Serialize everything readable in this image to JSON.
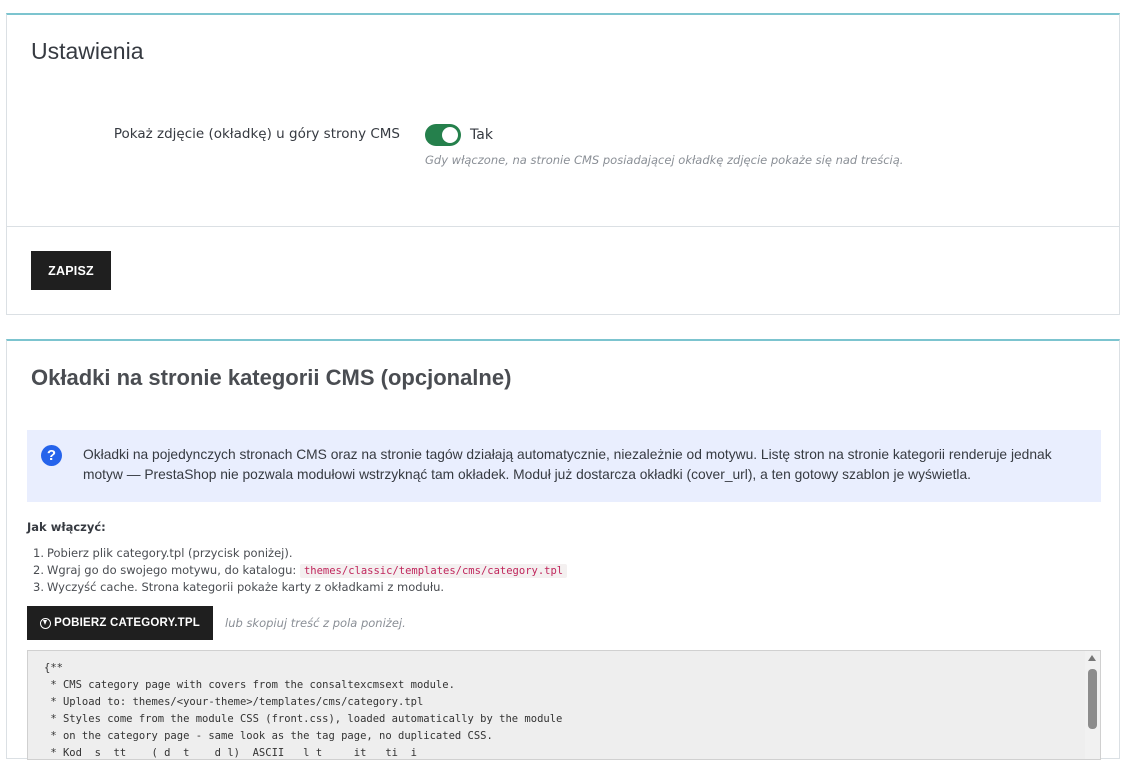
{
  "settings": {
    "title": "Ustawienia",
    "show_cover_label": "Pokaż zdjęcie (okładkę) u góry strony CMS",
    "toggle_state": "Tak",
    "help_text": "Gdy włączone, na stronie CMS posiadającej okładkę zdjęcie pokaże się nad treścią.",
    "save_label": "ZAPISZ",
    "toggle_color": "#25804c"
  },
  "covers": {
    "title": "Okładki na stronie kategorii CMS (opcjonalne)",
    "info_icon": "question-circle-icon",
    "info_text": "Okładki na pojedynczych stronach CMS oraz na stronie tagów działają automatycznie, niezależnie od motywu. Listę stron na stronie kategorii renderuje jednak motyw — PrestaShop nie pozwala modułowi wstrzyknąć tam okładek. Moduł już dostarcza okładki (cover_url), a ten gotowy szablon je wyświetla.",
    "howto_title": "Jak włączyć:",
    "steps": [
      {
        "num": "1.",
        "text": "Pobierz plik category.tpl (przycisk poniżej).",
        "code": ""
      },
      {
        "num": "2.",
        "text": "Wgraj go do swojego motywu, do katalogu: ",
        "code": "themes/classic/templates/cms/category.tpl"
      },
      {
        "num": "3.",
        "text": "Wyczyść cache. Strona kategorii pokaże karty z okładkami z modułu.",
        "code": ""
      }
    ],
    "download_label": "POBIERZ CATEGORY.TPL",
    "or_text": "lub skopiuj treść z pola poniżej.",
    "code_lines": [
      "{**",
      " * CMS category page with covers from the consaltexcmsext module.",
      " * Upload to: themes/<your-theme>/templates/cms/category.tpl",
      " * Styles come from the module CSS (front.css), loaded automatically by the module",
      " * on the category page - same look as the tag page, no duplicated CSS.",
      " * Kod  s  tt    ( d  t    d l)  ASCII   l t     it   ti  i"
    ]
  }
}
